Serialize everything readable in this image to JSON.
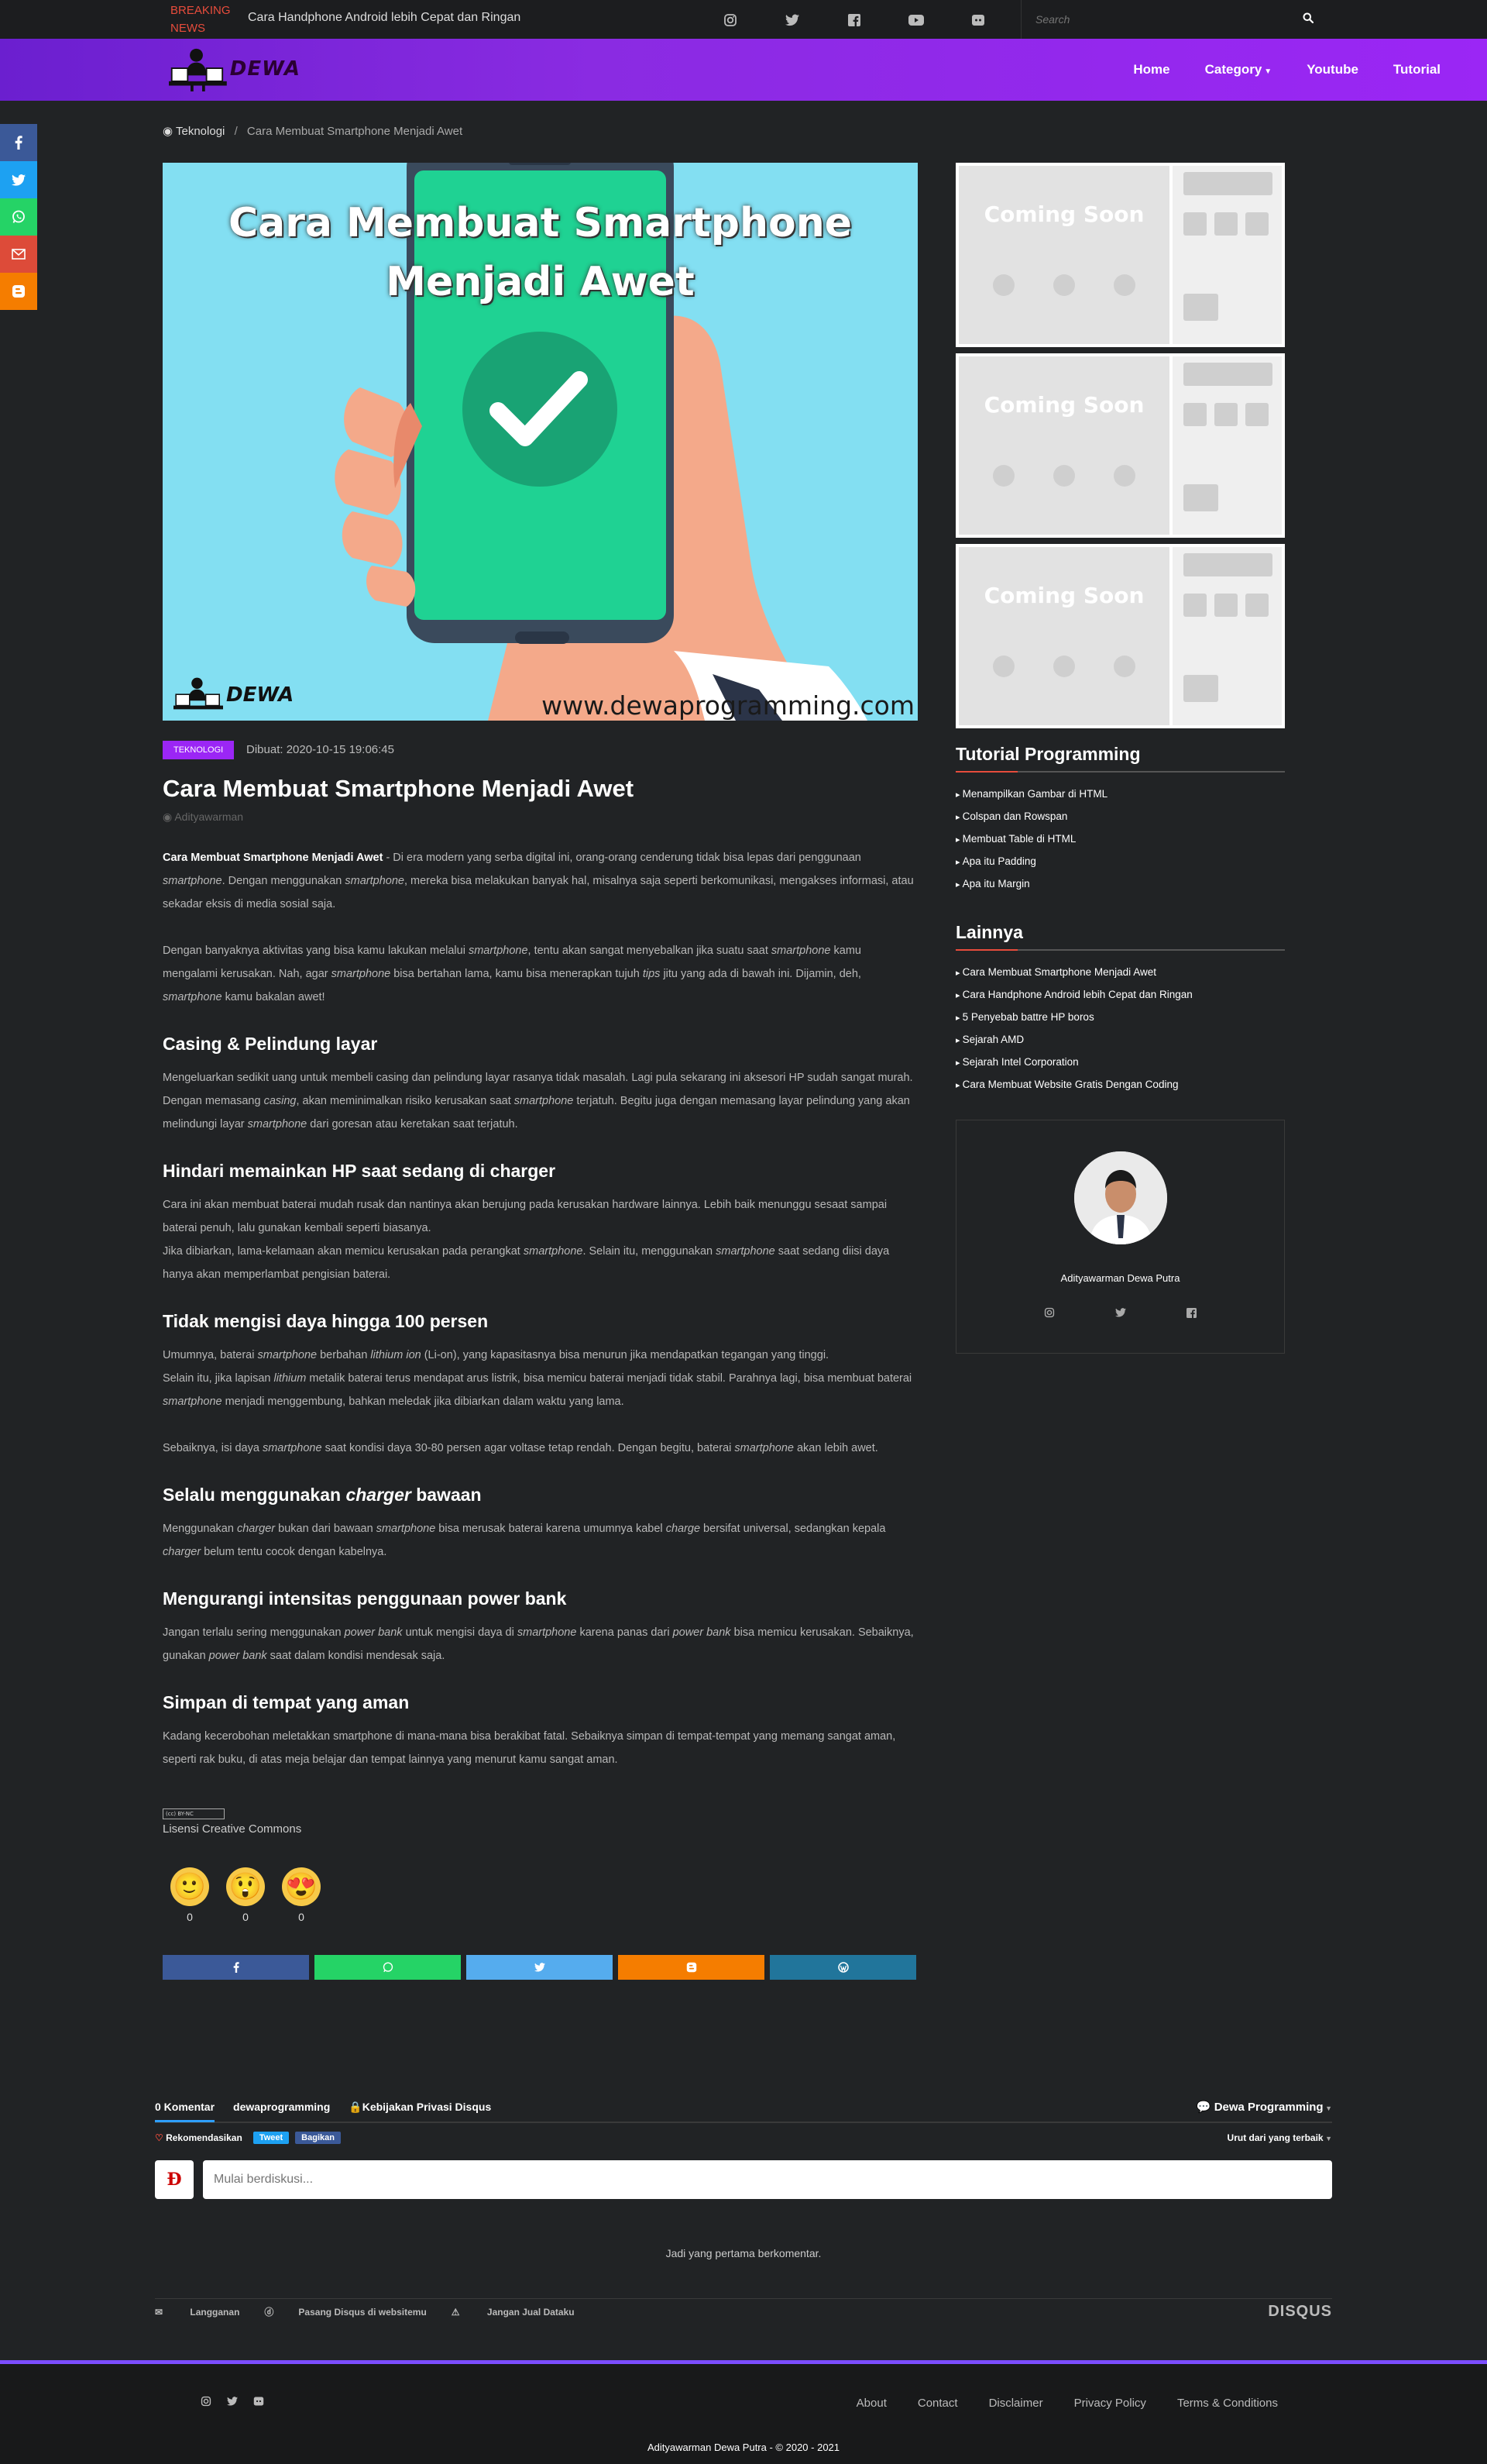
{
  "topbar": {
    "breaking_label": "BREAKING NEWS",
    "breaking_text": "Cara Handphone Android lebih Cepat dan Ringan",
    "social_icons": [
      "instagram-icon",
      "twitter-icon",
      "facebook-icon",
      "youtube-icon",
      "discord-icon"
    ],
    "search_placeholder": "Search"
  },
  "navbar": {
    "logo_text": "DEWA",
    "menu": [
      "Home",
      "Category",
      "Youtube",
      "Tutorial"
    ]
  },
  "side_share": {
    "buttons": [
      "facebook-icon",
      "twitter-icon",
      "whatsapp-icon",
      "gmail-icon",
      "blogger-icon"
    ],
    "colors": [
      "#3b5998",
      "#1da1f2",
      "#25d366",
      "#dd4b39",
      "#f57d00"
    ]
  },
  "breadcrumb": {
    "home": "Teknologi",
    "separator": "/",
    "current": "Cara Membuat Smartphone Menjadi Awet"
  },
  "hero": {
    "title": "Cara Membuat Smartphone Menjadi Awet",
    "url": "www.dewaprogramming.com",
    "logo_text": "DEWA"
  },
  "post": {
    "tag": "TEKNOLOGI",
    "date": "Dibuat: 2020-10-15 19:06:45",
    "title": "Cara Membuat Smartphone Menjadi Awet",
    "author": "Adityawarman"
  },
  "article": {
    "intro_bold": "Cara Membuat Smartphone Menjadi Awet",
    "intro_1": " - Di era modern yang serba digital ini, orang-orang cenderung tidak bisa lepas dari penggunaan ",
    "intro_em1": "smartphone",
    "intro_2": ". Dengan menggunakan ",
    "intro_em2": "smartphone",
    "intro_3": ", mereka bisa melakukan banyak hal, misalnya saja seperti berkomunikasi, mengakses informasi, atau sekadar eksis di media sosial saja.",
    "p2_1": "Dengan banyaknya aktivitas yang bisa kamu lakukan melalui ",
    "p2_em1": "smartphone",
    "p2_2": ", tentu akan sangat menyebalkan jika suatu saat ",
    "p2_em2": "smartphone",
    "p2_3": " kamu mengalami kerusakan. Nah, agar ",
    "p2_em3": "smartphone",
    "p2_4": " bisa bertahan lama, kamu bisa menerapkan tujuh ",
    "p2_em4": "tips",
    "p2_5": " jitu yang ada di bawah ini. Dijamin, deh, ",
    "p2_em5": "smartphone",
    "p2_6": " kamu bakalan awet!",
    "h1": "Casing & Pelindung layar",
    "s1_1": "Mengeluarkan sedikit uang untuk membeli casing dan pelindung layar rasanya tidak masalah. Lagi pula sekarang ini aksesori HP sudah sangat murah. Dengan memasang ",
    "s1_em1": "casing",
    "s1_2": ", akan meminimalkan risiko kerusakan saat ",
    "s1_em2": "smartphone",
    "s1_3": " terjatuh. Begitu juga dengan memasang layar pelindung yang akan melindungi layar ",
    "s1_em3": "smartphone",
    "s1_4": " dari goresan atau keretakan saat terjatuh.",
    "h2": "Hindari memainkan HP saat sedang di charger",
    "s2_1": "Cara ini akan membuat baterai mudah rusak dan nantinya akan berujung pada kerusakan hardware lainnya. Lebih baik menunggu sesaat sampai baterai penuh, lalu gunakan kembali seperti biasanya.",
    "s2_2": "Jika dibiarkan, lama-kelamaan akan memicu kerusakan pada perangkat ",
    "s2_em1": "smartphone",
    "s2_3": ". Selain itu, menggunakan ",
    "s2_em2": "smartphone",
    "s2_4": " saat sedang diisi daya hanya akan memperlambat pengisian baterai.",
    "h3": "Tidak mengisi daya hingga 100 persen",
    "s3_1": "Umumnya, baterai ",
    "s3_em1": "smartphone",
    "s3_2": " berbahan ",
    "s3_em2": "lithium ion",
    "s3_3": " (Li-on), yang kapasitasnya bisa menurun jika mendapatkan tegangan yang tinggi.",
    "s3_4": "Selain itu, jika lapisan ",
    "s3_em3": "lithium",
    "s3_5": " metalik baterai terus mendapat arus listrik, bisa memicu baterai menjadi tidak stabil. Parahnya lagi, bisa membuat baterai ",
    "s3_em4": "smartphone",
    "s3_6": " menjadi menggembung, bahkan meledak jika dibiarkan dalam waktu yang lama.",
    "s3_7": "Sebaiknya, isi daya ",
    "s3_em5": "smartphone",
    "s3_8": " saat kondisi daya 30-80 persen agar voltase tetap rendah. Dengan begitu, baterai ",
    "s3_em6": "smartphone",
    "s3_9": " akan lebih awet.",
    "h4_1": "Selalu menggunakan ",
    "h4_em": "charger",
    "h4_2": " bawaan",
    "s4_1": "Menggunakan ",
    "s4_em1": "charger",
    "s4_2": " bukan dari bawaan ",
    "s4_em2": "smartphone",
    "s4_3": " bisa merusak baterai karena umumnya kabel ",
    "s4_em3": "charge",
    "s4_4": " bersifat universal, sedangkan kepala ",
    "s4_em4": "charger",
    "s4_5": " belum tentu cocok dengan kabelnya.",
    "h5": "Mengurangi intensitas penggunaan power bank",
    "s5_1": "Jangan terlalu sering menggunakan ",
    "s5_em1": "power bank",
    "s5_2": " untuk mengisi daya di ",
    "s5_em2": "smartphone",
    "s5_3": " karena panas dari ",
    "s5_em3": "power bank",
    "s5_4": " bisa memicu kerusakan. Sebaiknya, gunakan ",
    "s5_em4": "power bank",
    "s5_5": " saat dalam kondisi mendesak saja.",
    "h6": "Simpan di tempat yang aman",
    "s6": "Kadang kecerobohan meletakkan smartphone di mana-mana bisa berakibat fatal. Sebaiknya simpan di tempat-tempat yang memang sangat aman, seperti rak buku, di atas meja belajar dan tempat lainnya yang menurut kamu sangat aman."
  },
  "license": {
    "badge": "(cc) BY-NC",
    "text": "Lisensi Creative Commons"
  },
  "reactions": [
    {
      "emoji": "🙂",
      "name": "smile-reaction-icon",
      "count": "0"
    },
    {
      "emoji": "😲",
      "name": "surprised-reaction-icon",
      "count": "0"
    },
    {
      "emoji": "😍",
      "name": "love-reaction-icon",
      "count": "0"
    }
  ],
  "share_bar": {
    "buttons": [
      "facebook-icon",
      "whatsapp-icon",
      "twitter-icon",
      "blogger-icon",
      "wordpress-icon"
    ],
    "colors": [
      "#3b5998",
      "#25d366",
      "#55acee",
      "#f57d00",
      "#21759b"
    ]
  },
  "sidebar": {
    "thumb_text": "Coming Soon",
    "tutorial_heading": "Tutorial Programming",
    "tutorial_items": [
      "Menampilkan Gambar di HTML",
      "Colspan dan Rowspan",
      "Membuat Table di HTML",
      "Apa itu Padding",
      "Apa itu Margin"
    ],
    "other_heading": "Lainnya",
    "other_items": [
      "Cara Membuat Smartphone Menjadi Awet",
      "Cara Handphone Android lebih Cepat dan Ringan",
      "5 Penyebab battre HP boros",
      "Sejarah AMD",
      "Sejarah Intel Corporation",
      "Cara Membuat Website Gratis Dengan Coding"
    ],
    "author_name": "Adityawarman Dewa Putra",
    "author_social": [
      "instagram-icon",
      "twitter-icon",
      "facebook-icon"
    ]
  },
  "disqus": {
    "tab_comments": "0 Komentar",
    "tab_site": "dewaprogramming",
    "tab_privacy": "Kebijakan Privasi Disqus",
    "login": "Dewa Programming",
    "recommend": "Rekomendasikan",
    "tweet": "Tweet",
    "share": "Bagikan",
    "sort": "Urut dari yang terbaik",
    "placeholder": "Mulai berdiskusi...",
    "first": "Jadi yang pertama berkomentar.",
    "subscribe": "Langganan",
    "install": "Pasang Disqus di websitemu",
    "nosell": "Jangan Jual Dataku",
    "brand": "DISQUS"
  },
  "footer": {
    "social": [
      "instagram-icon",
      "twitter-icon",
      "discord-icon"
    ],
    "links": [
      "About",
      "Contact",
      "Disclaimer",
      "Privacy Policy",
      "Terms & Conditions"
    ],
    "copyright": "Adityawarman Dewa Putra - © 2020 - 2021"
  }
}
